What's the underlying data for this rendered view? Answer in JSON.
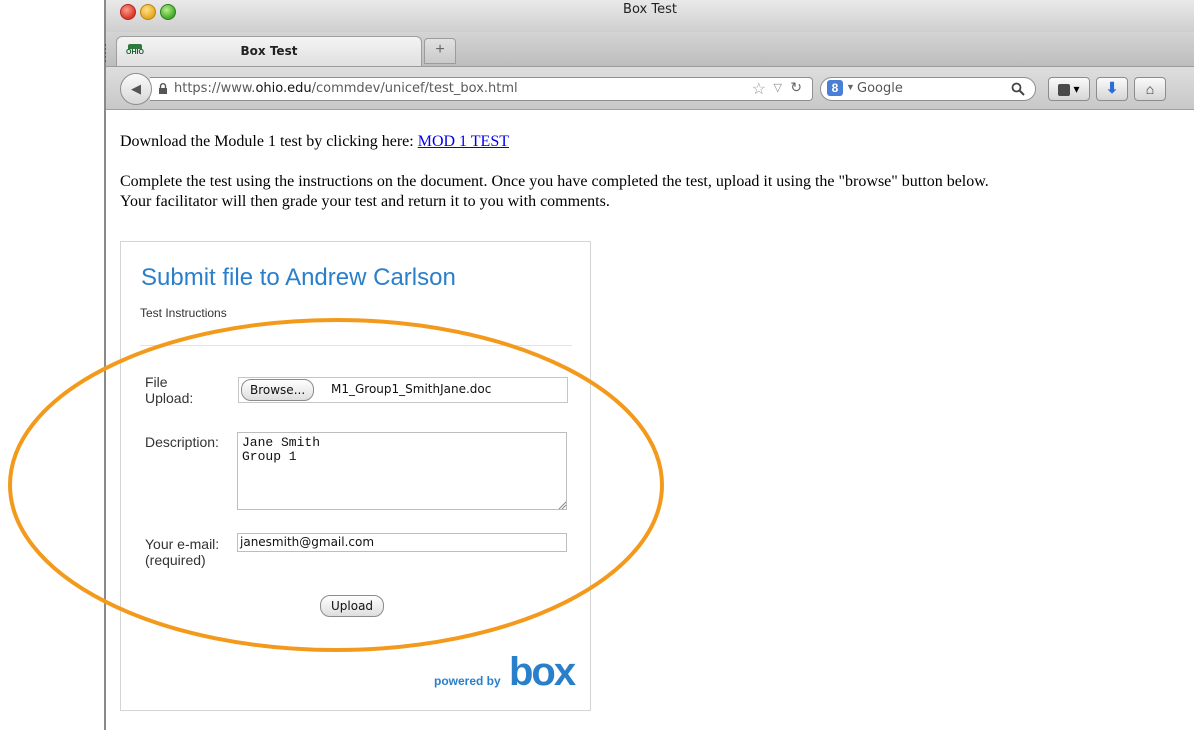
{
  "window": {
    "title": "Box Test"
  },
  "tabs": [
    {
      "label": "Box Test",
      "favicon": "OHIO"
    }
  ],
  "new_tab_label": "+",
  "navbar": {
    "url_prefix": "https://www.",
    "url_domain": "ohio.edu",
    "url_path": "/commdev/unicef/test_box.html",
    "search_engine_glyph": "8",
    "search_placeholder": "Google"
  },
  "page": {
    "intro_text": "Download the Module 1 test by clicking here: ",
    "intro_link": "MOD 1 TEST",
    "instructions_line1": "Complete the test using the instructions on the document. Once you have completed the test, upload it using the \"browse\" button below.",
    "instructions_line2": "Your facilitator will then grade your test and return it to you with comments."
  },
  "box_form": {
    "title": "Submit file to Andrew Carlson",
    "subtitle": "Test Instructions",
    "file_label_line1": "File",
    "file_label_line2": "Upload:",
    "browse_label": "Browse...",
    "file_name": "M1_Group1_SmithJane.doc",
    "description_label": "Description:",
    "description_value": "Jane Smith\nGroup 1",
    "email_label_line1": "Your e-mail:",
    "email_label_line2": "(required)",
    "email_value": "janesmith@gmail.com",
    "upload_label": "Upload",
    "powered_by": "powered by",
    "logo_text": "box"
  },
  "colors": {
    "accent_blue": "#2a7fcb",
    "highlight_orange": "#f39a1c",
    "link": "#0000ee"
  }
}
